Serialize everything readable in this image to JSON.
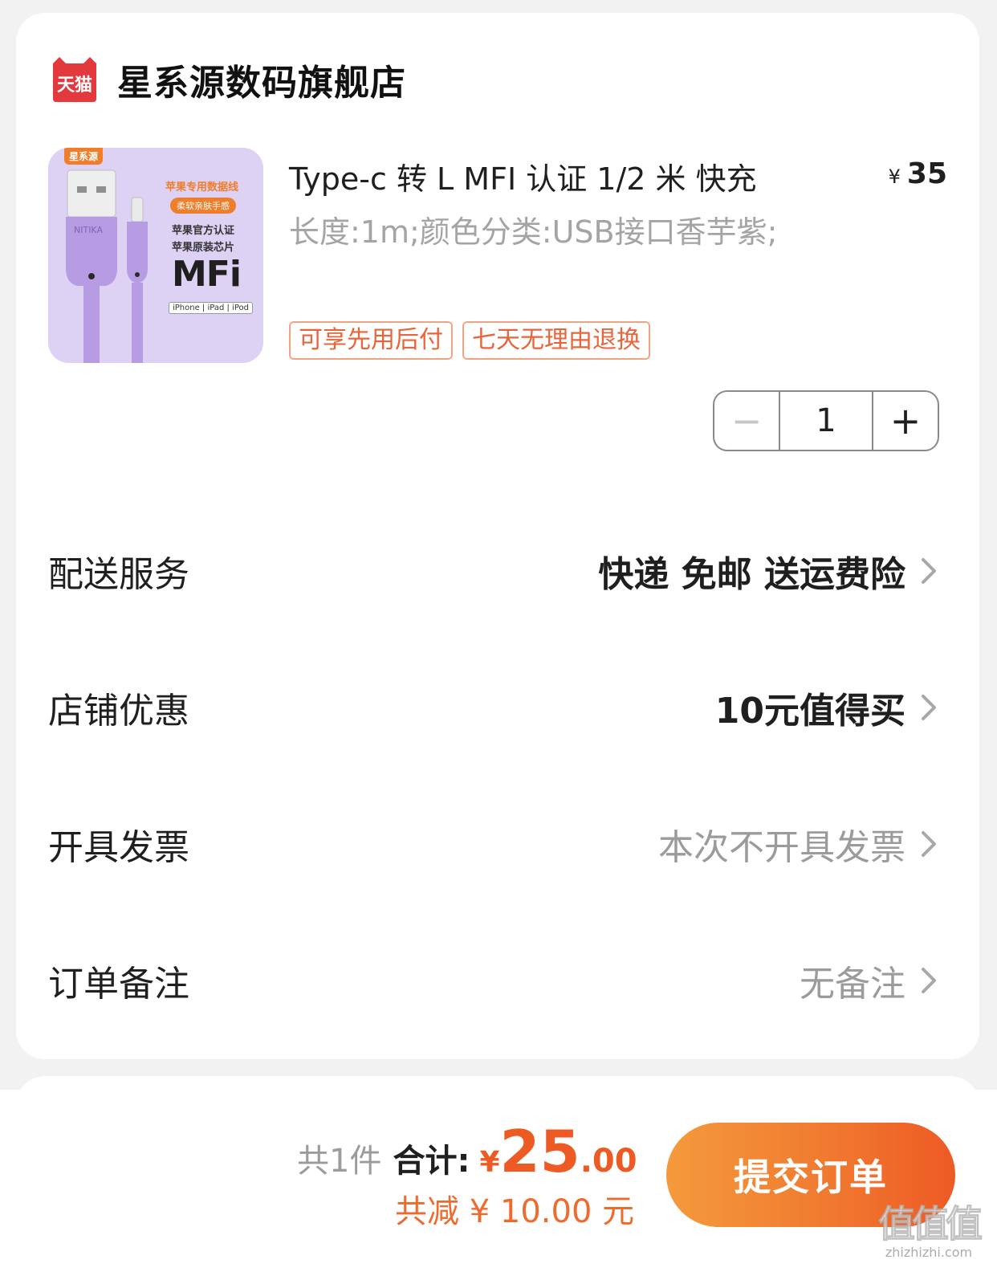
{
  "shop": {
    "logo_text": "天猫",
    "name": "星系源数码旗舰店"
  },
  "product": {
    "title": "Type-c 转 L MFI 认证 1/2 米 快充",
    "price_currency": "¥",
    "price": "35",
    "spec": "长度:1m;颜色分类:USB接口香芋紫;",
    "tags": [
      "可享先用后付",
      "七天无理由退换"
    ],
    "image": {
      "brand": "星系源",
      "line1": "苹果专用数据线",
      "pill": "柔软亲肤手感",
      "line2": "苹果官方认证",
      "line3": "苹果原装芯片",
      "mfi": "MFi",
      "compat": "iPhone | iPad | iPod",
      "cable_brand": "NITIKA"
    },
    "quantity": "1",
    "minus_label": "−",
    "plus_label": "+"
  },
  "rows": [
    {
      "label": "配送服务",
      "value": "快递 免邮 送运费险"
    },
    {
      "label": "店铺优惠",
      "value": "10元值得买"
    },
    {
      "label": "开具发票",
      "value": "本次不开具发票"
    },
    {
      "label": "订单备注",
      "value": "无备注"
    }
  ],
  "footer": {
    "count_text": "共1件",
    "total_label": "合计:",
    "total_currency": "¥",
    "total_int": "25",
    "total_dec": ".00",
    "saving_text": "共减 ¥ 10.00 元",
    "submit_label": "提交订单"
  },
  "watermark": {
    "big": "值值值",
    "small": "zhizhizhi.com"
  },
  "colors": {
    "accent": "#ee5a24",
    "tmall_red": "#e4393c",
    "tag_border": "#f2a585"
  }
}
